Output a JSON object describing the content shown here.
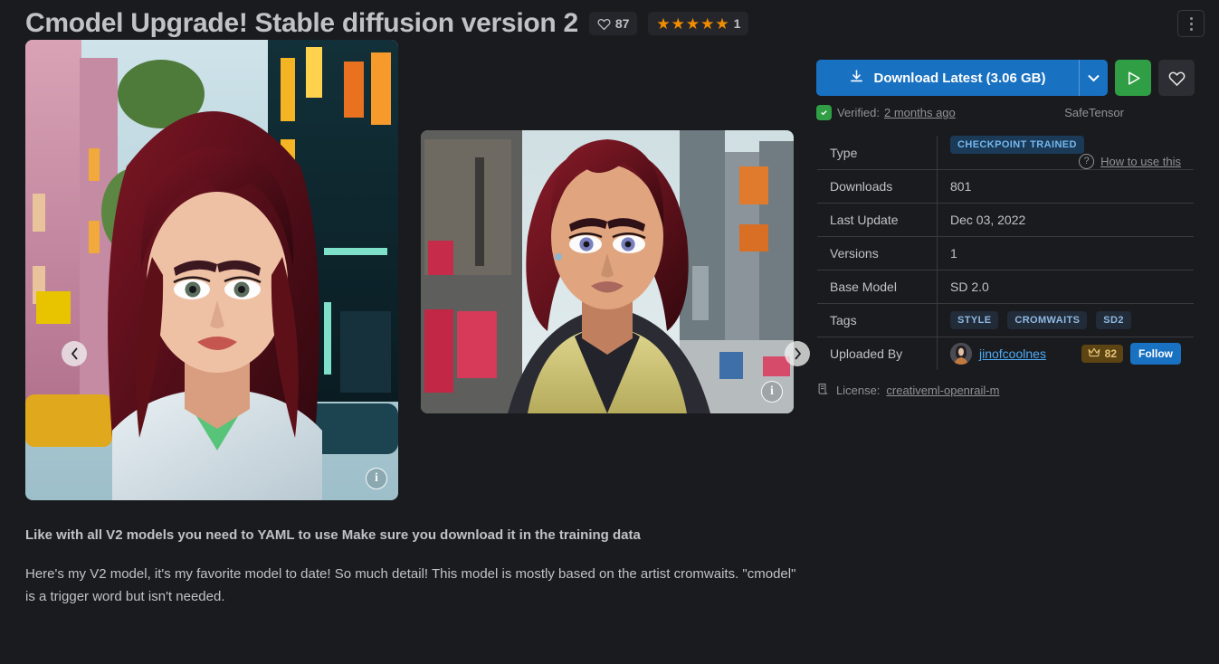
{
  "header": {
    "title": "Cmodel Upgrade! Stable diffusion version 2",
    "likes": "87",
    "rating_count": "1",
    "star_count": 5,
    "heart_icon": "heart-outline-icon",
    "menu_icon": "more-vertical-icon"
  },
  "carousel": {
    "prev_label": "‹",
    "next_label": "›",
    "info_label": "i",
    "images": [
      {
        "alt": "Portrait of red-haired woman in city street, anime illustration style"
      },
      {
        "alt": "Portrait of woman with fur-collared leather jacket in city street"
      }
    ]
  },
  "description": {
    "heading": "Like with all V2 models you need to YAML to use Make sure you download it in the training data",
    "paragraph": "Here's my V2 model, it's my favorite model to date! So much detail! This model is mostly based on the artist cromwaits. \"cmodel\" is a trigger word but isn't needed."
  },
  "sidebar": {
    "download_label": "Download Latest (3.06 GB)",
    "download_icon": "download-icon",
    "caret_icon": "chevron-down-icon",
    "run_icon": "play-icon",
    "favorite_icon": "heart-outline-icon",
    "verified_prefix": "Verified:",
    "verified_time": "2 months ago",
    "verified_icon": "shield-check-icon",
    "format": "SafeTensor",
    "table": [
      {
        "key": "Type",
        "value": "CHECKPOINT TRAINED",
        "kind": "pill"
      },
      {
        "key": "Downloads",
        "value": "801",
        "kind": "text"
      },
      {
        "key": "Last Update",
        "value": "Dec 03, 2022",
        "kind": "text"
      },
      {
        "key": "Versions",
        "value": "1",
        "kind": "text"
      },
      {
        "key": "Base Model",
        "value": "SD 2.0",
        "kind": "text"
      },
      {
        "key": "Tags",
        "value": "",
        "kind": "tags"
      },
      {
        "key": "Uploaded By",
        "value": "",
        "kind": "uploader"
      }
    ],
    "type_label": "Type",
    "type_value": "CHECKPOINT TRAINED",
    "howto_label": "How to use this",
    "howto_icon": "question-circle-icon",
    "downloads_label": "Downloads",
    "downloads_value": "801",
    "last_update_label": "Last Update",
    "last_update_value": "Dec 03, 2022",
    "versions_label": "Versions",
    "versions_value": "1",
    "base_model_label": "Base Model",
    "base_model_value": "SD 2.0",
    "tags_label": "Tags",
    "tags": [
      "STYLE",
      "CROMWAITS",
      "SD2"
    ],
    "uploaded_by_label": "Uploaded By",
    "uploader_name": "jinofcoolnes",
    "uploader_rank": "82",
    "crown_icon": "crown-icon",
    "follow_label": "Follow",
    "license_prefix": "License:",
    "license_value": "creativeml-openrail-m",
    "license_icon": "license-scroll-icon"
  },
  "colors": {
    "background": "#1a1b1e",
    "accent_blue": "#1971c2",
    "accent_green": "#2f9e44",
    "star_orange": "#f08c00",
    "link_blue": "#4dabf7",
    "pill_bg": "#1b3a57",
    "pill_text": "#74b8f0",
    "crown_bg": "#5c4413",
    "crown_text": "#e8c37a",
    "text_primary": "#c1c2c5",
    "text_muted": "#909296",
    "border": "#373a40"
  }
}
